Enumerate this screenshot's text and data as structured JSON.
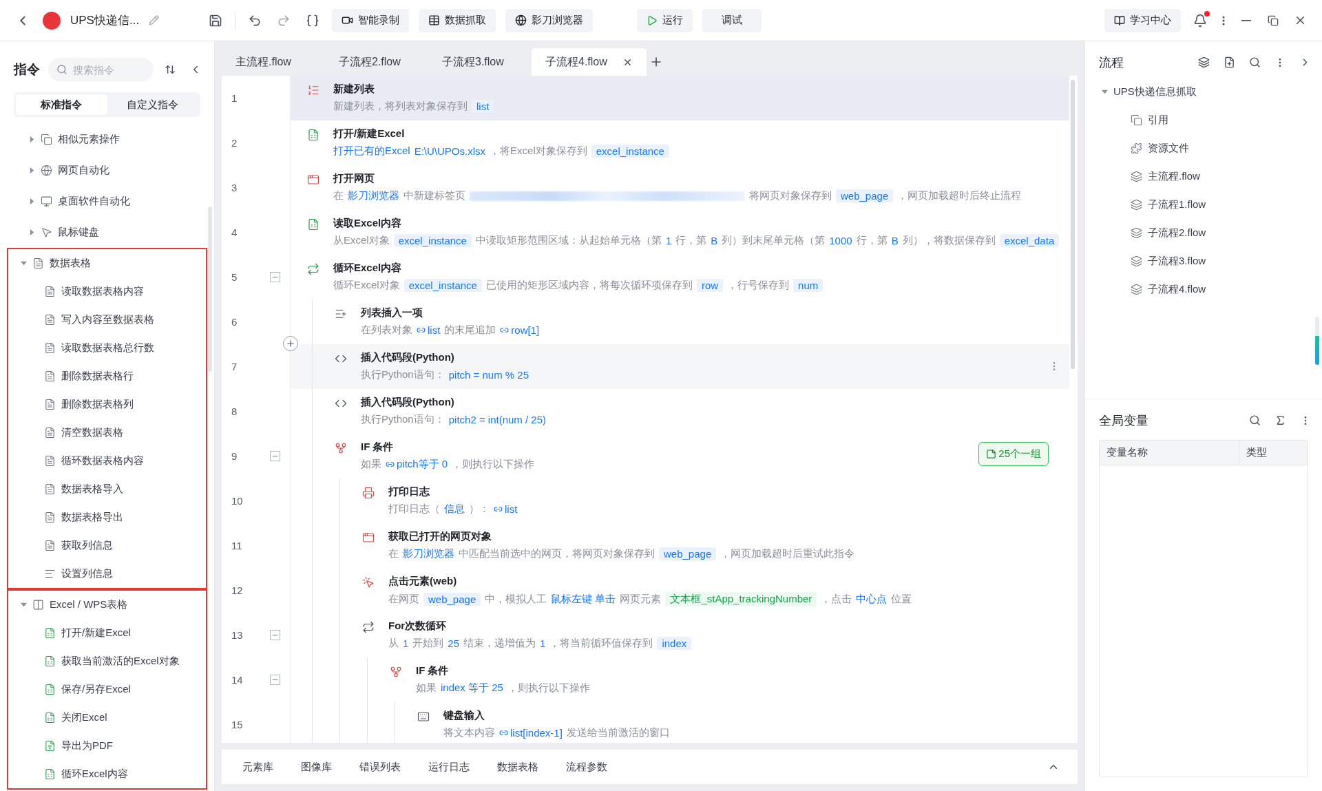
{
  "topbar": {
    "title": "UPS快递信...",
    "tools": [
      "智能录制",
      "数据抓取",
      "影刀浏览器"
    ],
    "run": "运行",
    "debug": "调试",
    "learn": "学习中心",
    "unread": true
  },
  "sidebar": {
    "title": "指令",
    "search_placeholder": "搜索指令",
    "tabs": [
      {
        "label": "标准指令",
        "selected": true
      },
      {
        "label": "自定义指令",
        "selected": false
      }
    ],
    "groups": [
      {
        "label": "相似元素操作",
        "kind": "copy",
        "expanded": false,
        "boxed": false
      },
      {
        "label": "网页自动化",
        "kind": "browser",
        "expanded": false,
        "boxed": false
      },
      {
        "label": "桌面软件自动化",
        "kind": "monitor",
        "expanded": false,
        "boxed": false
      },
      {
        "label": "鼠标键盘",
        "kind": "pointer",
        "expanded": false,
        "boxed": false
      },
      {
        "label": "数据表格",
        "kind": "doc",
        "expanded": true,
        "boxed": true,
        "children": [
          {
            "label": "读取数据表格内容",
            "kind": "doc"
          },
          {
            "label": "写入内容至数据表格",
            "kind": "doc"
          },
          {
            "label": "读取数据表格总行数",
            "kind": "doc"
          },
          {
            "label": "删除数据表格行",
            "kind": "doc"
          },
          {
            "label": "删除数据表格列",
            "kind": "doc"
          },
          {
            "label": "清空数据表格",
            "kind": "doc"
          },
          {
            "label": "循环数据表格内容",
            "kind": "doc"
          },
          {
            "label": "数据表格导入",
            "kind": "doc"
          },
          {
            "label": "数据表格导出",
            "kind": "doc"
          },
          {
            "label": "获取列信息",
            "kind": "doc"
          },
          {
            "label": "设置列信息",
            "kind": "lines"
          }
        ]
      },
      {
        "label": "Excel / WPS表格",
        "kind": "sheet",
        "expanded": true,
        "boxed": true,
        "children": [
          {
            "label": "打开/新建Excel",
            "kind": "excel"
          },
          {
            "label": "获取当前激活的Excel对象",
            "kind": "excel"
          },
          {
            "label": "保存/另存Excel",
            "kind": "excel"
          },
          {
            "label": "关闭Excel",
            "kind": "excel"
          },
          {
            "label": "导出为PDF",
            "kind": "pdf"
          },
          {
            "label": "循环Excel内容",
            "kind": "excel"
          }
        ]
      }
    ]
  },
  "editor": {
    "tabs": [
      {
        "label": "主流程.flow",
        "selected": false
      },
      {
        "label": "子流程2.flow",
        "selected": false
      },
      {
        "label": "子流程3.flow",
        "selected": false
      },
      {
        "label": "子流程4.flow",
        "selected": true
      }
    ],
    "steps": [
      {
        "line": "1",
        "kind": "list",
        "title": "新建列表",
        "selected": true,
        "hover": false,
        "desc": [
          {
            "kind": "t",
            "text": "新建列表，将列表对象保存到"
          },
          {
            "kind": "chip",
            "text": "list"
          }
        ]
      },
      {
        "line": "2",
        "kind": "excel",
        "title": "打开/新建Excel",
        "selected": false,
        "hover": false,
        "desc": [
          {
            "kind": "link",
            "text": "打开已有的Excel"
          },
          {
            "kind": "link",
            "text": "E:\\U\\UPOs.xlsx"
          },
          {
            "kind": "t",
            "text": "，将Excel对象保存到"
          },
          {
            "kind": "chip",
            "text": "excel_instance"
          }
        ]
      },
      {
        "line": "3",
        "kind": "web",
        "title": "打开网页",
        "selected": false,
        "hover": false,
        "desc": [
          {
            "kind": "t",
            "text": "在"
          },
          {
            "kind": "link",
            "text": "影刀浏览器"
          },
          {
            "kind": "t",
            "text": "中新建标签页"
          },
          {
            "kind": "blur"
          },
          {
            "kind": "t",
            "text": "将网页对象保存到"
          },
          {
            "kind": "chip",
            "text": "web_page"
          },
          {
            "kind": "t",
            "text": "，网页加载超时后终止流程"
          }
        ]
      },
      {
        "line": "4",
        "kind": "excel",
        "title": "读取Excel内容",
        "selected": false,
        "hover": false,
        "desc": [
          {
            "kind": "t",
            "text": "从Excel对象"
          },
          {
            "kind": "chip",
            "text": "excel_instance"
          },
          {
            "kind": "t",
            "text": "中读取矩形范围区域：从起始单元格（第"
          },
          {
            "kind": "link",
            "text": "1"
          },
          {
            "kind": "t",
            "text": "行，第"
          },
          {
            "kind": "link",
            "text": "B"
          },
          {
            "kind": "t",
            "text": "列）到末尾单元格（第"
          },
          {
            "kind": "link",
            "text": "1000"
          },
          {
            "kind": "t",
            "text": "行，第"
          },
          {
            "kind": "link",
            "text": "B"
          },
          {
            "kind": "t",
            "text": "列），将数据保存到"
          },
          {
            "kind": "chip",
            "text": "excel_data"
          }
        ]
      },
      {
        "line": "5",
        "kind": "loop",
        "title": "循环Excel内容",
        "selected": false,
        "hover": false,
        "expanded": true,
        "desc": [
          {
            "kind": "t",
            "text": "循环Excel对象"
          },
          {
            "kind": "chip",
            "text": "excel_instance"
          },
          {
            "kind": "t",
            "text": "已使用的矩形区域内容，将每次循环项保存到"
          },
          {
            "kind": "chip",
            "text": "row"
          },
          {
            "kind": "t",
            "text": "，行号保存到"
          },
          {
            "kind": "chip",
            "text": "num"
          }
        ],
        "children": [
          {
            "line": "6",
            "kind": "listadd",
            "title": "列表插入一项",
            "selected": false,
            "hover": false,
            "desc": [
              {
                "kind": "t",
                "text": "在列表对象"
              },
              {
                "kind": "var",
                "text": "list"
              },
              {
                "kind": "t",
                "text": "的末尾追加"
              },
              {
                "kind": "var",
                "text": "row[1]"
              }
            ]
          },
          {
            "line": "7",
            "kind": "code",
            "title": "插入代码段(Python)",
            "selected": false,
            "hover": true,
            "desc": [
              {
                "kind": "t",
                "text": "执行Python语句："
              },
              {
                "kind": "link",
                "text": "pitch = num % 25"
              }
            ]
          },
          {
            "line": "8",
            "kind": "code",
            "title": "插入代码段(Python)",
            "selected": false,
            "hover": false,
            "desc": [
              {
                "kind": "t",
                "text": "执行Python语句："
              },
              {
                "kind": "link",
                "text": "pitch2 = int(num / 25)"
              }
            ]
          },
          {
            "line": "9",
            "kind": "if",
            "title": "IF 条件",
            "selected": false,
            "hover": false,
            "expanded": true,
            "note": "25个一组",
            "desc": [
              {
                "kind": "t",
                "text": "如果"
              },
              {
                "kind": "var",
                "text": "pitch等于 0"
              },
              {
                "kind": "t",
                "text": "，则执行以下操作"
              }
            ],
            "children": [
              {
                "line": "10",
                "kind": "print",
                "title": "打印日志",
                "selected": false,
                "hover": false,
                "desc": [
                  {
                    "kind": "t",
                    "text": "打印日志（"
                  },
                  {
                    "kind": "link",
                    "text": "信息"
                  },
                  {
                    "kind": "t",
                    "text": "）："
                  },
                  {
                    "kind": "var",
                    "text": "list"
                  }
                ]
              },
              {
                "line": "11",
                "kind": "web",
                "title": "获取已打开的网页对象",
                "selected": false,
                "hover": false,
                "desc": [
                  {
                    "kind": "t",
                    "text": "在"
                  },
                  {
                    "kind": "link",
                    "text": "影刀浏览器"
                  },
                  {
                    "kind": "t",
                    "text": "中匹配当前选中的网页，将网页对象保存到"
                  },
                  {
                    "kind": "chip",
                    "text": "web_page"
                  },
                  {
                    "kind": "t",
                    "text": "，网页加载超时后重试此指令"
                  }
                ]
              },
              {
                "line": "12",
                "kind": "click",
                "title": "点击元素(web)",
                "selected": false,
                "hover": false,
                "desc": [
                  {
                    "kind": "t",
                    "text": "在网页"
                  },
                  {
                    "kind": "chip",
                    "text": "web_page"
                  },
                  {
                    "kind": "t",
                    "text": "中，模拟人工"
                  },
                  {
                    "kind": "link",
                    "text": "鼠标左键 单击"
                  },
                  {
                    "kind": "t",
                    "text": "网页元素"
                  },
                  {
                    "kind": "green",
                    "text": "文本框_stApp_trackingNumber"
                  },
                  {
                    "kind": "t",
                    "text": "，点击"
                  },
                  {
                    "kind": "link",
                    "text": "中心点"
                  },
                  {
                    "kind": "t",
                    "text": "位置"
                  }
                ]
              },
              {
                "line": "13",
                "kind": "for",
                "title": "For次数循环",
                "selected": false,
                "hover": false,
                "expanded": true,
                "desc": [
                  {
                    "kind": "t",
                    "text": "从"
                  },
                  {
                    "kind": "link",
                    "text": "1"
                  },
                  {
                    "kind": "t",
                    "text": "开始到"
                  },
                  {
                    "kind": "link",
                    "text": "25"
                  },
                  {
                    "kind": "t",
                    "text": "结束，递增值为"
                  },
                  {
                    "kind": "link",
                    "text": "1"
                  },
                  {
                    "kind": "t",
                    "text": "，将当前循环值保存到"
                  },
                  {
                    "kind": "chip",
                    "text": "index"
                  }
                ],
                "children": [
                  {
                    "line": "14",
                    "kind": "if",
                    "title": "IF 条件",
                    "selected": false,
                    "hover": false,
                    "expanded": true,
                    "desc": [
                      {
                        "kind": "t",
                        "text": "如果"
                      },
                      {
                        "kind": "link",
                        "text": "index 等于 25"
                      },
                      {
                        "kind": "t",
                        "text": "，则执行以下操作"
                      }
                    ],
                    "children": [
                      {
                        "line": "15",
                        "kind": "keyboard",
                        "title": "键盘输入",
                        "selected": false,
                        "hover": false,
                        "desc": [
                          {
                            "kind": "t",
                            "text": "将文本内容"
                          },
                          {
                            "kind": "var",
                            "text": "list[index-1]"
                          },
                          {
                            "kind": "t",
                            "text": "发送给当前激活的窗口"
                          }
                        ]
                      }
                    ]
                  }
                ]
              }
            ]
          }
        ]
      }
    ]
  },
  "bottom_tabs": [
    "元素库",
    "图像库",
    "错误列表",
    "运行日志",
    "数据表格",
    "流程参数"
  ],
  "flow_panel": {
    "title": "流程",
    "root": {
      "label": "UPS快递信息抓取",
      "expanded": true,
      "children": [
        {
          "label": "引用",
          "kind": "copy"
        },
        {
          "label": "资源文件",
          "kind": "puzzle"
        },
        {
          "label": "主流程.flow",
          "kind": "layers"
        },
        {
          "label": "子流程1.flow",
          "kind": "layers"
        },
        {
          "label": "子流程2.flow",
          "kind": "layers"
        },
        {
          "label": "子流程3.flow",
          "kind": "layers"
        },
        {
          "label": "子流程4.flow",
          "kind": "layers"
        }
      ]
    }
  },
  "globals": {
    "title": "全局变量",
    "columns": [
      "变量名称",
      "类型"
    ]
  }
}
